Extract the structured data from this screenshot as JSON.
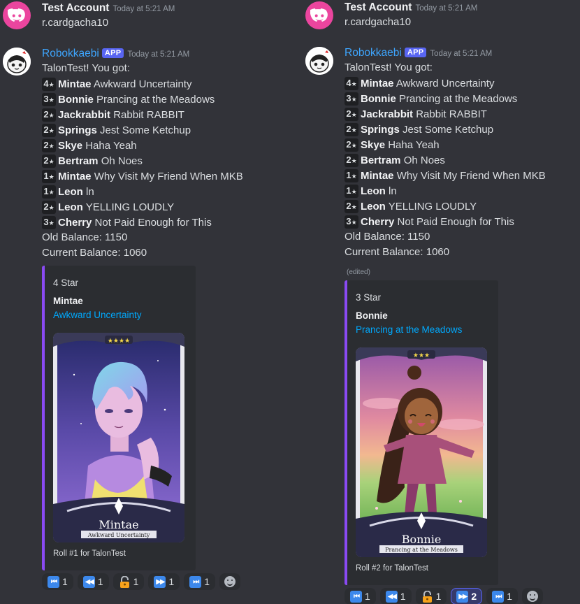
{
  "user_message": {
    "author": "Test Account",
    "timestamp": "Today at 5:21 AM",
    "text": "r.cardgacha10"
  },
  "bot": {
    "author": "Robokkaebi",
    "badge": "APP",
    "timestamp": "Today at 5:21 AM",
    "intro": "TalonTest! You got:"
  },
  "pulls": [
    {
      "stars": "4",
      "name": "Mintae",
      "title": "Awkward Uncertainty"
    },
    {
      "stars": "3",
      "name": "Bonnie",
      "title": "Prancing at the Meadows"
    },
    {
      "stars": "2",
      "name": "Jackrabbit",
      "title": "Rabbit RABBIT"
    },
    {
      "stars": "2",
      "name": "Springs",
      "title": "Jest Some Ketchup"
    },
    {
      "stars": "2",
      "name": "Skye",
      "title": "Haha Yeah"
    },
    {
      "stars": "2",
      "name": "Bertram",
      "title": "Oh Noes"
    },
    {
      "stars": "1",
      "name": "Mintae",
      "title": "Why Visit My Friend When MKB"
    },
    {
      "stars": "1",
      "name": "Leon",
      "title": "ln"
    },
    {
      "stars": "2",
      "name": "Leon",
      "title": "YELLING LOUDLY"
    },
    {
      "stars": "3",
      "name": "Cherry",
      "title": "Not Paid Enough for This"
    }
  ],
  "star_glyph": "★",
  "balance": {
    "old": "Old Balance: 1150",
    "current": "Current Balance: 1060"
  },
  "left_embed": {
    "star_label": "4 Star",
    "name": "Mintae",
    "title": "Awkward Uncertainty",
    "card_caption_name": "Mintae",
    "card_caption_title": "Awkward Uncertainty",
    "card_stars": "★★★★",
    "footer": "Roll #1 for TalonTest"
  },
  "right_embed": {
    "edited": "(edited)",
    "star_label": "3 Star",
    "name": "Bonnie",
    "title": "Prancing at the Meadows",
    "card_caption_name": "Bonnie",
    "card_caption_title": "Prancing at the Meadows",
    "card_stars": "★★★",
    "footer": "Roll #2 for TalonTest"
  },
  "reactions_left": [
    {
      "icon": "first-page-icon",
      "glyph": "⏮",
      "count": "1"
    },
    {
      "icon": "previous-icon",
      "glyph": "◀◀",
      "count": "1"
    },
    {
      "icon": "lock-icon",
      "glyph": "",
      "count": "1"
    },
    {
      "icon": "next-icon",
      "glyph": "▶▶",
      "count": "1"
    },
    {
      "icon": "last-page-icon",
      "glyph": "⏭",
      "count": "1"
    }
  ],
  "reactions_right": [
    {
      "icon": "first-page-icon",
      "glyph": "⏮",
      "count": "1"
    },
    {
      "icon": "previous-icon",
      "glyph": "◀◀",
      "count": "1"
    },
    {
      "icon": "lock-icon",
      "glyph": "",
      "count": "1"
    },
    {
      "icon": "next-icon",
      "glyph": "▶▶",
      "count": "2"
    },
    {
      "icon": "last-page-icon",
      "glyph": "⏭",
      "count": "1"
    }
  ],
  "colors": {
    "background": "#323339",
    "embed_accent": "#8a4af3",
    "link": "#00a8fc",
    "bot_name": "#3ea6ff",
    "app_badge": "#5865f2"
  }
}
